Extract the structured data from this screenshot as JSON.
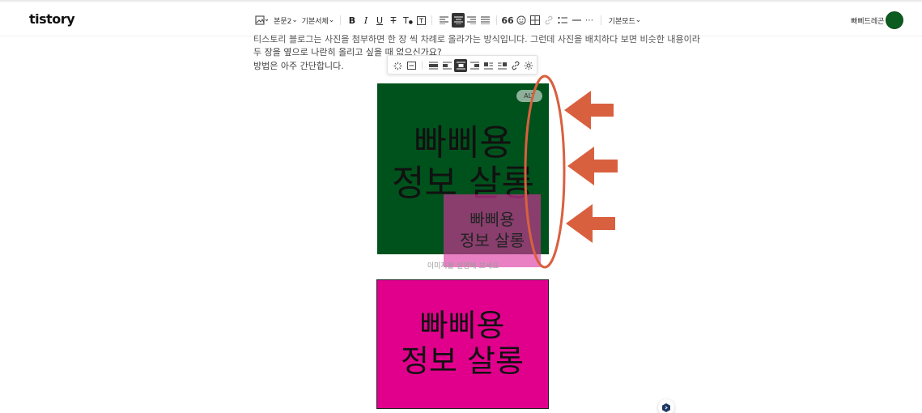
{
  "app": {
    "logo": "tistory"
  },
  "toolbar": {
    "paragraph_style": "본문2",
    "font_family": "기본서체",
    "mode": "기본모드"
  },
  "user": {
    "name": "빠삐드레곤"
  },
  "content": {
    "line1": "티스토리 블로그는 사진을 첨부하면 한 장 씩 차례로 올라가는 방식입니다. 그런데 사진을 배치하다 보면 비슷한 내용이라",
    "line2": "두 장을 옆으로 나란히 올리고 싶을 때 없으신가요?",
    "line3": "방법은 아주 간단합니다."
  },
  "images": {
    "green": {
      "line1": "빠삐용",
      "line2": "정보 살롱"
    },
    "pink_overlay": {
      "line1": "빠삐용",
      "line2": "정보 살롱"
    },
    "pink": {
      "line1": "빠삐용",
      "line2": "정보 살롱"
    },
    "alt_badge": "ALT",
    "caption_placeholder": "이미지를 설명해 보세요"
  },
  "colors": {
    "green_image": "#00521c",
    "pink_image": "#e0008c",
    "annotation": "#d9603f",
    "avatar": "#0b5c1e"
  },
  "icons": {
    "toolbar": [
      "image-icon",
      "bold-icon",
      "italic-icon",
      "underline-icon",
      "strikethrough-icon",
      "text-color-icon",
      "text-background-icon",
      "align-left-icon",
      "align-center-icon",
      "align-right-icon",
      "align-justify-icon",
      "quote-icon",
      "emoji-icon",
      "table-icon",
      "link-icon",
      "bulleted-list-icon",
      "horizontal-rule-icon",
      "more-icon"
    ],
    "image_toolbar": [
      "ai-sparkle-icon",
      "image-resize-icon",
      "layout-full-icon",
      "layout-wrap-left-icon",
      "layout-center-icon",
      "layout-wrap-right-icon",
      "layout-float-left-icon",
      "layout-float-right-icon",
      "link-icon",
      "settings-icon"
    ],
    "annotations": [
      "arrow-left-icon",
      "arrow-left-icon",
      "arrow-left-icon",
      "highlight-ellipse"
    ]
  }
}
